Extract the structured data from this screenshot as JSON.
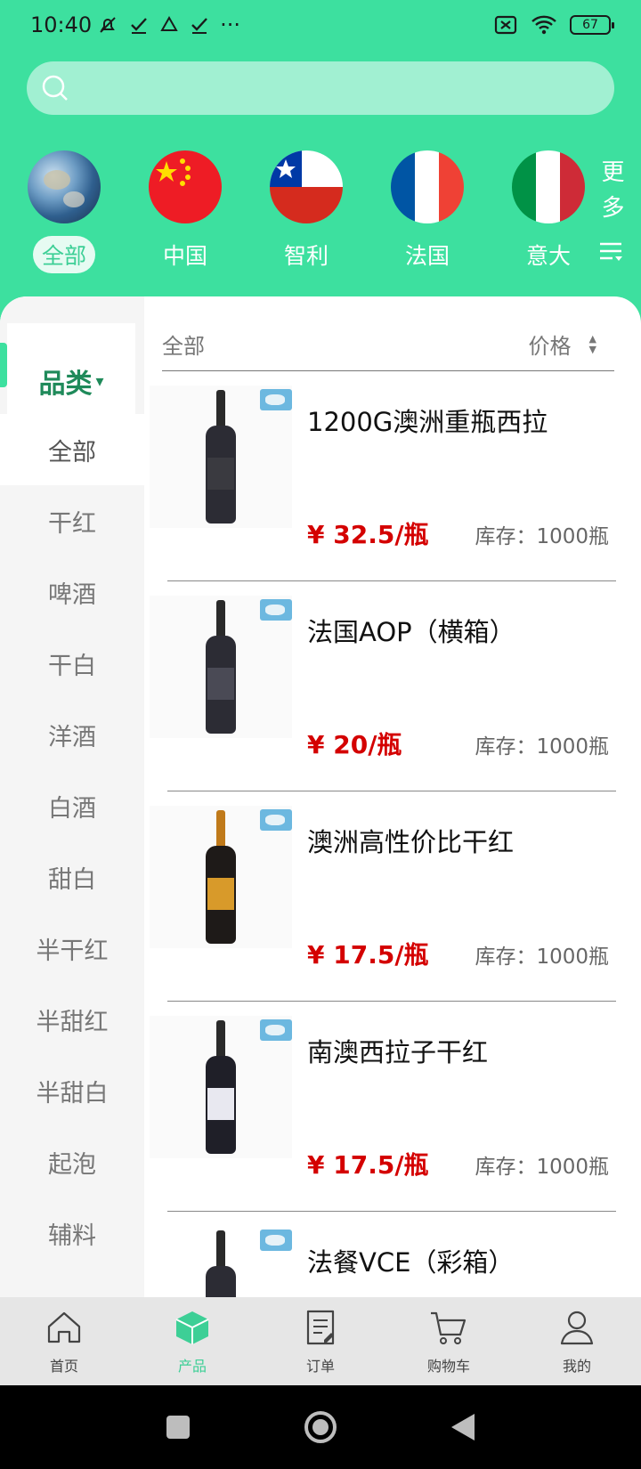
{
  "status": {
    "time": "10:40",
    "dots": "···",
    "battery": "67"
  },
  "search": {
    "placeholder": ""
  },
  "countries": [
    {
      "label": "全部",
      "icon": "earth-icon",
      "active": true
    },
    {
      "label": "中国",
      "icon": "china-flag-icon"
    },
    {
      "label": "智利",
      "icon": "chile-flag-icon"
    },
    {
      "label": "法国",
      "icon": "france-flag-icon"
    },
    {
      "label": "意大",
      "icon": "italy-flag-icon"
    }
  ],
  "more_label": "更多",
  "sidebar": {
    "header": "品类",
    "header_arrow": "▾",
    "items": [
      "全部",
      "干红",
      "啤酒",
      "干白",
      "洋酒",
      "白酒",
      "甜白",
      "半干红",
      "半甜红",
      "半甜白",
      "起泡",
      "辅料"
    ]
  },
  "filter": {
    "category": "全部",
    "sort_label": "价格",
    "sort_up": "▲",
    "sort_down": "▼"
  },
  "products": [
    {
      "name": "1200G澳洲重瓶西拉",
      "price": "¥ 32.5/瓶",
      "stock": "库存：1000瓶",
      "label_color": "#3a3a40"
    },
    {
      "name": "法国AOP（横箱）",
      "price": "¥ 20/瓶",
      "stock": "库存：1000瓶",
      "label_color": "#4a4a55"
    },
    {
      "name": "澳洲高性价比干红",
      "price": "¥ 17.5/瓶",
      "stock": "库存：1000瓶",
      "label_color": "#d89a2a"
    },
    {
      "name": "南澳西拉子干红",
      "price": "¥ 17.5/瓶",
      "stock": "库存：1000瓶",
      "label_color": "#e8e8f0"
    },
    {
      "name": "法餐VCE（彩箱）",
      "price": "",
      "stock": "",
      "label_color": "#2c2c34"
    }
  ],
  "tabs": [
    {
      "label": "首页",
      "icon": "home-icon"
    },
    {
      "label": "产品",
      "icon": "product-box-icon",
      "active": true
    },
    {
      "label": "订单",
      "icon": "order-icon"
    },
    {
      "label": "购物车",
      "icon": "cart-icon"
    },
    {
      "label": "我的",
      "icon": "profile-icon"
    }
  ],
  "colors": {
    "brand": "#3de09f",
    "price": "#d40000",
    "active_text": "#3dcf96"
  }
}
